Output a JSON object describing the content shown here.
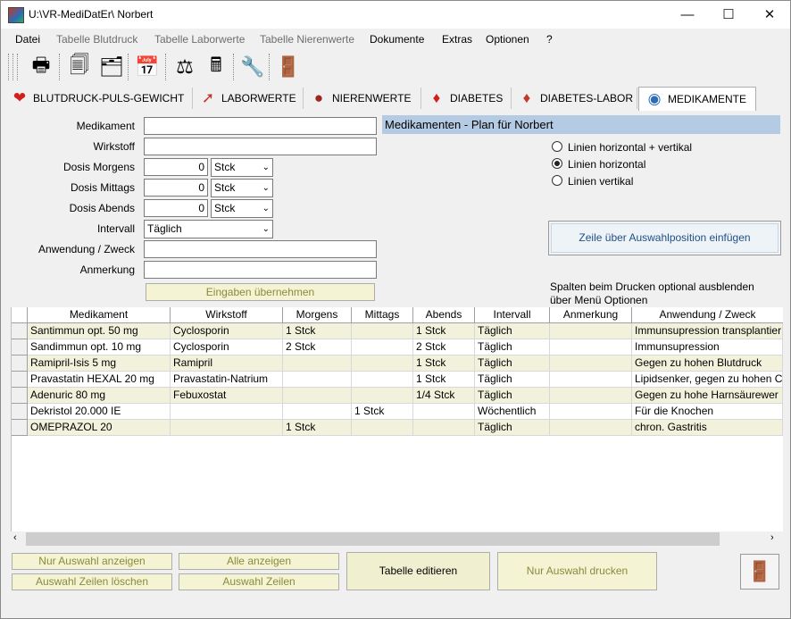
{
  "window": {
    "title": "U:\\VR-MediDatEr\\ Norbert"
  },
  "menu": [
    "Datei",
    "Tabelle Blutdruck",
    "Tabelle Laborwerte",
    "Tabelle Nierenwerte",
    "Dokumente",
    "Extras",
    "Optionen",
    "?"
  ],
  "tabs": [
    {
      "label": "BLUTDRUCK-PULS-GEWICHT",
      "icon": "heart-icon"
    },
    {
      "label": "LABORWERTE",
      "icon": "syringe-icon"
    },
    {
      "label": "NIERENWERTE",
      "icon": "kidney-icon"
    },
    {
      "label": "DIABETES",
      "icon": "blood-drop-icon"
    },
    {
      "label": "DIABETES-LABOR",
      "icon": "blood-drop-syringe-icon"
    },
    {
      "label": "MEDIKAMENTE",
      "icon": "pills-icon"
    }
  ],
  "form": {
    "medikament_label": "Medikament",
    "wirkstoff_label": "Wirkstoff",
    "dosis_morgens_label": "Dosis Morgens",
    "dosis_mittags_label": "Dosis Mittags",
    "dosis_abends_label": "Dosis Abends",
    "intervall_label": "Intervall",
    "anwendung_label": "Anwendung / Zweck",
    "anmerkung_label": "Anmerkung",
    "medikament_value": "",
    "wirkstoff_value": "",
    "dosis_morgens_value": "0",
    "dosis_mittags_value": "0",
    "dosis_abends_value": "0",
    "unit": "Stck",
    "intervall_value": "Täglich",
    "anwendung_value": "",
    "anmerkung_value": "",
    "submit_label": "Eingaben übernehmen"
  },
  "plan": {
    "header": "Medikamenten - Plan für  Norbert",
    "options": [
      {
        "label": "Linien horizontal + vertikal",
        "checked": false
      },
      {
        "label": "Linien horizontal",
        "checked": true
      },
      {
        "label": "Linien vertikal",
        "checked": false
      }
    ],
    "insert_button": "Zeile über Auswahlposition einfügen",
    "hint_line1": "Spalten beim Drucken optional ausblenden",
    "hint_line2": "über Menü Optionen"
  },
  "table": {
    "columns": [
      "Medikament",
      "Wirkstoff",
      "Morgens",
      "Mittags",
      "Abends",
      "Intervall",
      "Anmerkung",
      "Anwendung / Zweck"
    ],
    "rows": [
      [
        "Santimmun opt. 50 mg",
        "Cyclosporin",
        "1 Stck",
        "",
        "1 Stck",
        "Täglich",
        "",
        "Immunsupression transplantier"
      ],
      [
        "Sandimmun opt. 10 mg",
        "Cyclosporin",
        "2 Stck",
        "",
        "2 Stck",
        "Täglich",
        "",
        "Immunsupression"
      ],
      [
        "Ramipril-Isis 5 mg",
        "Ramipril",
        "",
        "",
        "1 Stck",
        "Täglich",
        "",
        "Gegen zu hohen Blutdruck"
      ],
      [
        "Pravastatin HEXAL 20 mg",
        "Pravastatin-Natrium",
        "",
        "",
        "1 Stck",
        "Täglich",
        "",
        "Lipidsenker, gegen zu hohen C"
      ],
      [
        "Adenuric 80 mg",
        "Febuxostat",
        "",
        "",
        "1/4 Stck",
        "Täglich",
        "",
        "Gegen zu hohe Harnsäurewer"
      ],
      [
        "Dekristol 20.000 IE",
        "",
        "",
        "1 Stck",
        "",
        "Wöchentlich",
        "",
        "Für die Knochen"
      ],
      [
        "OMEPRAZOL 20",
        "",
        "1 Stck",
        "",
        "",
        "Täglich",
        "",
        " chron. Gastritis"
      ]
    ]
  },
  "buttons": {
    "nur_auswahl_anzeigen": "Nur Auswahl anzeigen",
    "alle_anzeigen": "Alle anzeigen",
    "auswahl_zeilen_loeschen": "Auswahl Zeilen löschen",
    "auswahl_zeilen": "Auswahl Zeilen",
    "tabelle_editieren": "Tabelle editieren",
    "nur_auswahl_drucken": "Nur Auswahl drucken"
  },
  "colors": {
    "accent_header": "#b4cbe3",
    "row_alt": "#f2f2dc",
    "button_face": "#f4f4d4"
  }
}
